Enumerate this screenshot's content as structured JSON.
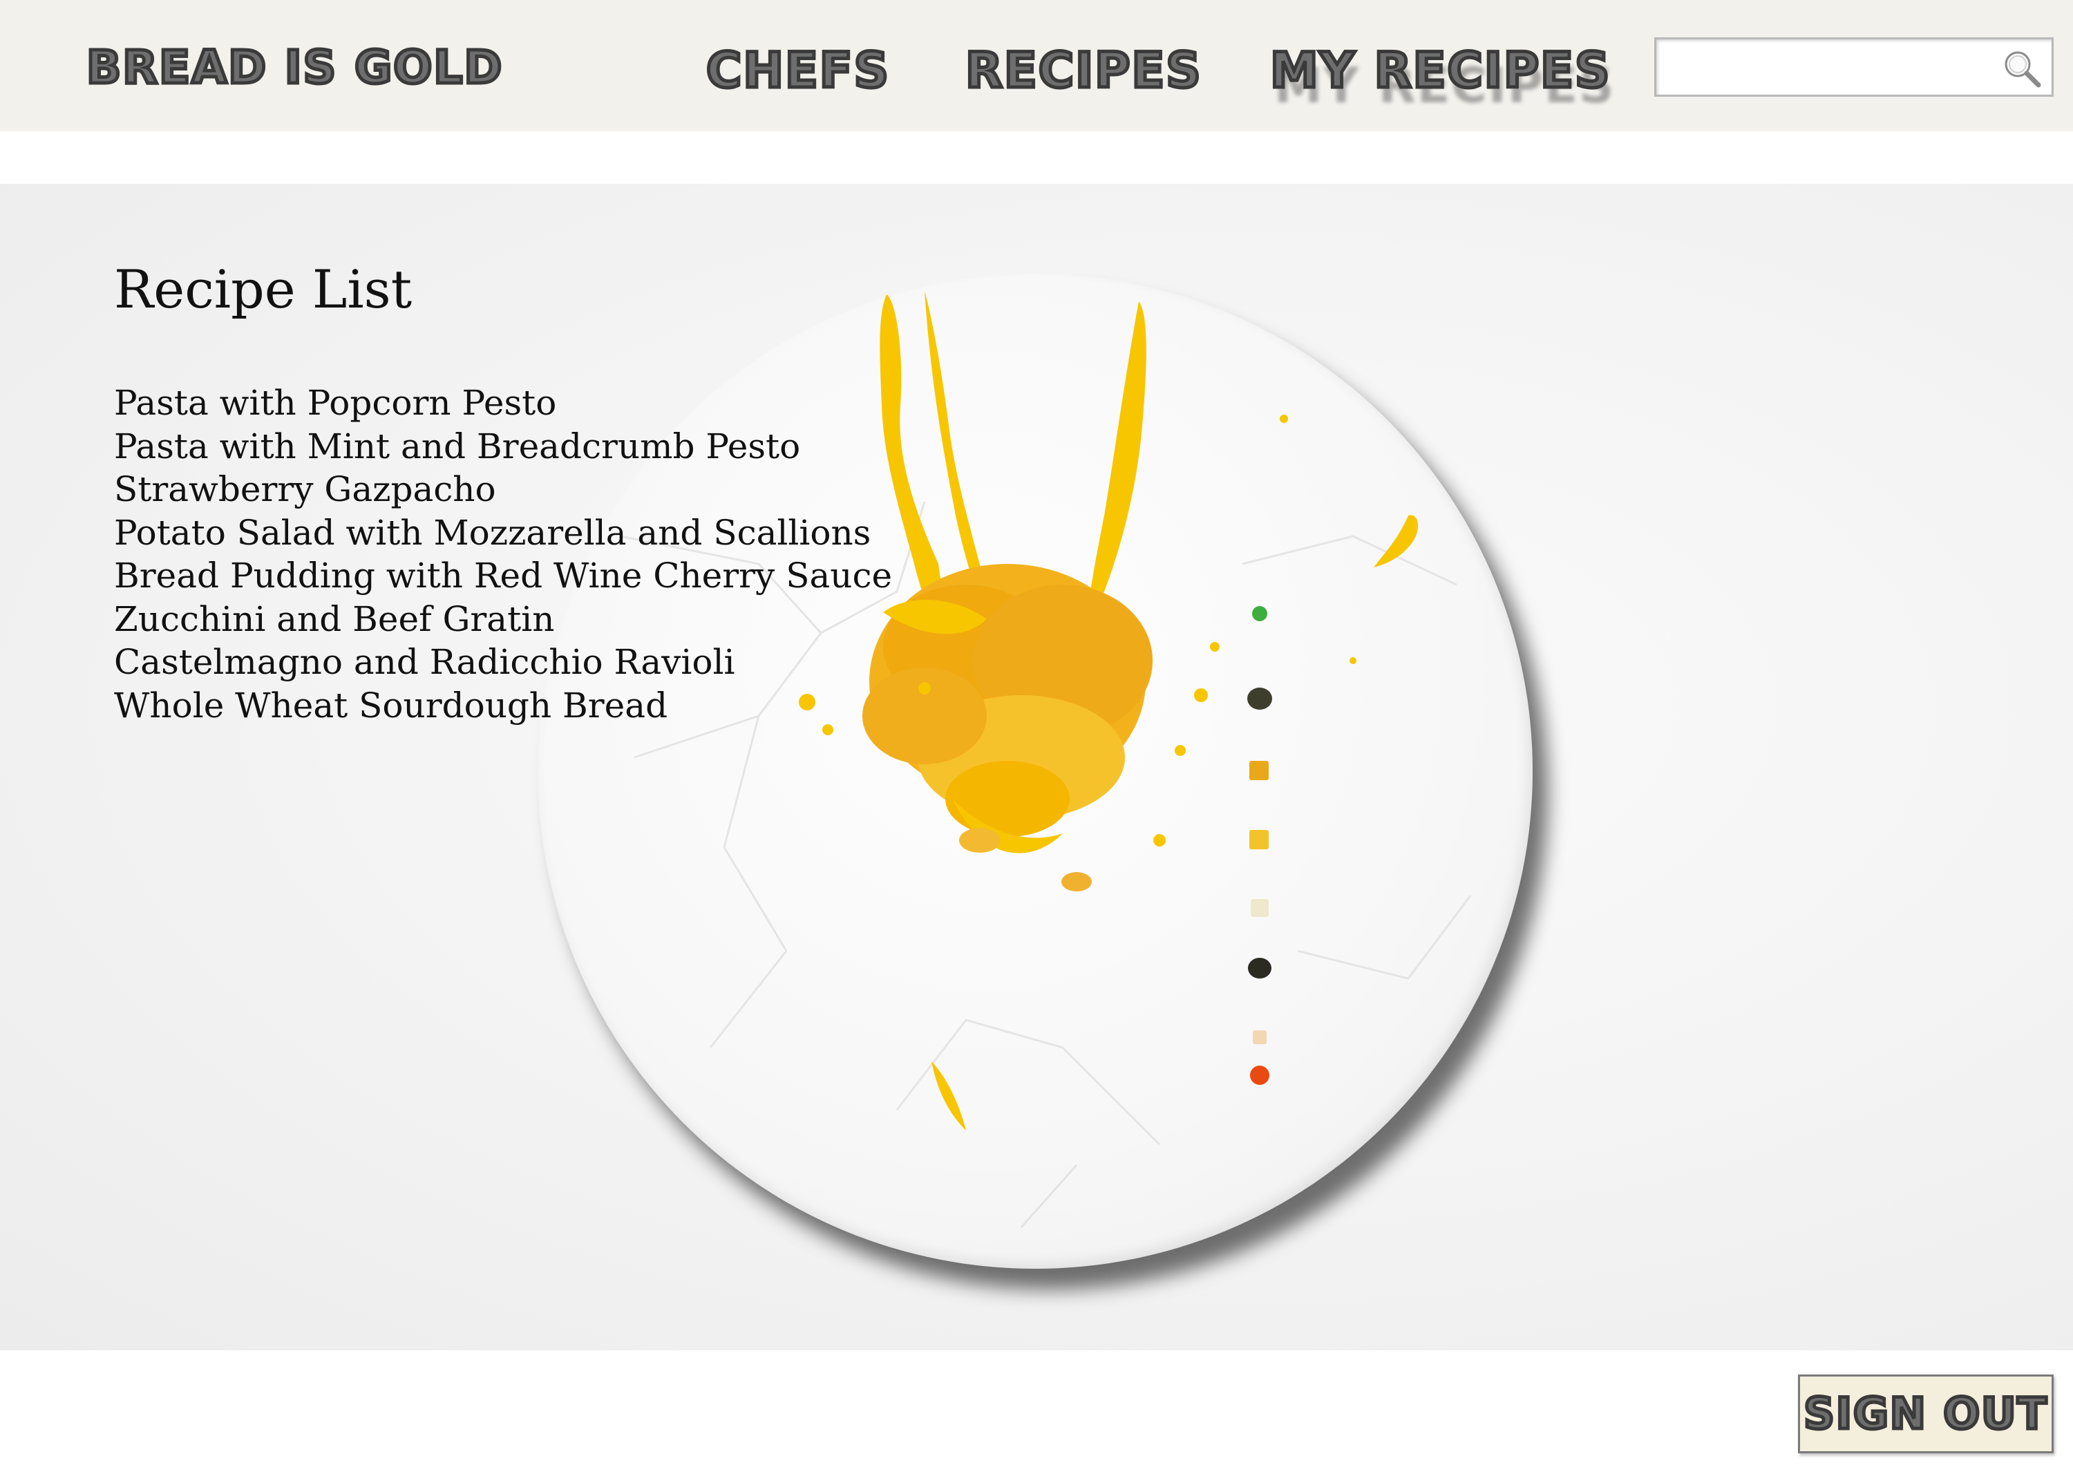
{
  "header": {
    "brand": "BREAD IS GOLD",
    "nav": [
      {
        "label": "CHEFS"
      },
      {
        "label": "RECIPES"
      },
      {
        "label": "MY RECIPES"
      }
    ],
    "search": {
      "value": "",
      "placeholder": "",
      "icon": "search-icon"
    }
  },
  "main": {
    "title": "Recipe List",
    "recipes": [
      "Pasta with Popcorn Pesto",
      "Pasta with Mint and Breadcrumb Pesto",
      "Strawberry Gazpacho",
      "Potato Salad with Mozzarella and Scallions",
      "Bread Pudding with Red Wine Cherry Sauce",
      "Zucchini and Beef Gratin",
      "Castelmagno and Radicchio Ravioli",
      "Whole Wheat Sourdough Bread"
    ],
    "image": "plate-dish-image"
  },
  "footer": {
    "signout_label": "SIGN OUT"
  },
  "colors": {
    "header_bg": "#f3f1ec",
    "nav_text": "#6e6e6e",
    "nav_stroke": "#3a3a3a",
    "button_bg": "#f4efdc",
    "sauce_yellow": "#f7c600"
  }
}
